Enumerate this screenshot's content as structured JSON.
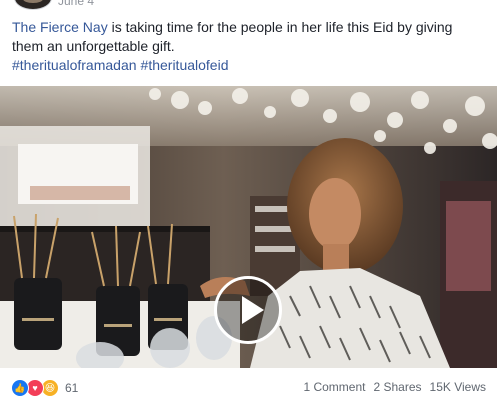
{
  "post": {
    "date": "June 4",
    "author_link": "The Fierce Nay",
    "text_rest": " is taking time for the people in her life this Eid by giving them an unforgettable gift.",
    "hashtags": [
      "#theritualoframadan",
      "#theritualofeid"
    ]
  },
  "reactions": {
    "icons": [
      "like-icon",
      "love-icon",
      "haha-icon"
    ],
    "count": "61"
  },
  "stats": {
    "comments": "1 Comment",
    "shares": "2 Shares",
    "views": "15K Views"
  },
  "colors": {
    "link": "#365899",
    "like": "#1877f2",
    "love": "#f33e58",
    "haha": "#f7b125"
  }
}
